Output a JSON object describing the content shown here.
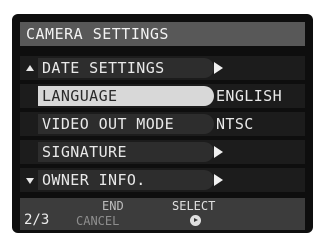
{
  "screen": {
    "title": "CAMERA SETTINGS"
  },
  "menu": {
    "items": [
      {
        "label": "DATE SETTINGS",
        "value": "",
        "has_submenu": true,
        "selected": false,
        "scroll_icon": "scroll-up-icon"
      },
      {
        "label": "LANGUAGE",
        "value": "ENGLISH",
        "has_submenu": false,
        "selected": true,
        "scroll_icon": ""
      },
      {
        "label": "VIDEO OUT MODE",
        "value": "NTSC",
        "has_submenu": false,
        "selected": false,
        "scroll_icon": ""
      },
      {
        "label": "SIGNATURE",
        "value": "",
        "has_submenu": true,
        "selected": false,
        "scroll_icon": ""
      },
      {
        "label": "OWNER INFO.",
        "value": "",
        "has_submenu": true,
        "selected": false,
        "scroll_icon": "scroll-down-icon"
      }
    ]
  },
  "footer": {
    "page": "2/3",
    "end_label": "END",
    "cancel_label": "CANCEL",
    "select_label": "SELECT",
    "select_icon": "ok-button-icon"
  },
  "colors": {
    "background": "#0e0e0e",
    "title_bar": "#585858",
    "row_pill": "#2d2d2d",
    "selected_pill": "#d8d8d8",
    "footer": "#3c3c3c",
    "text": "#e9e9e9"
  }
}
